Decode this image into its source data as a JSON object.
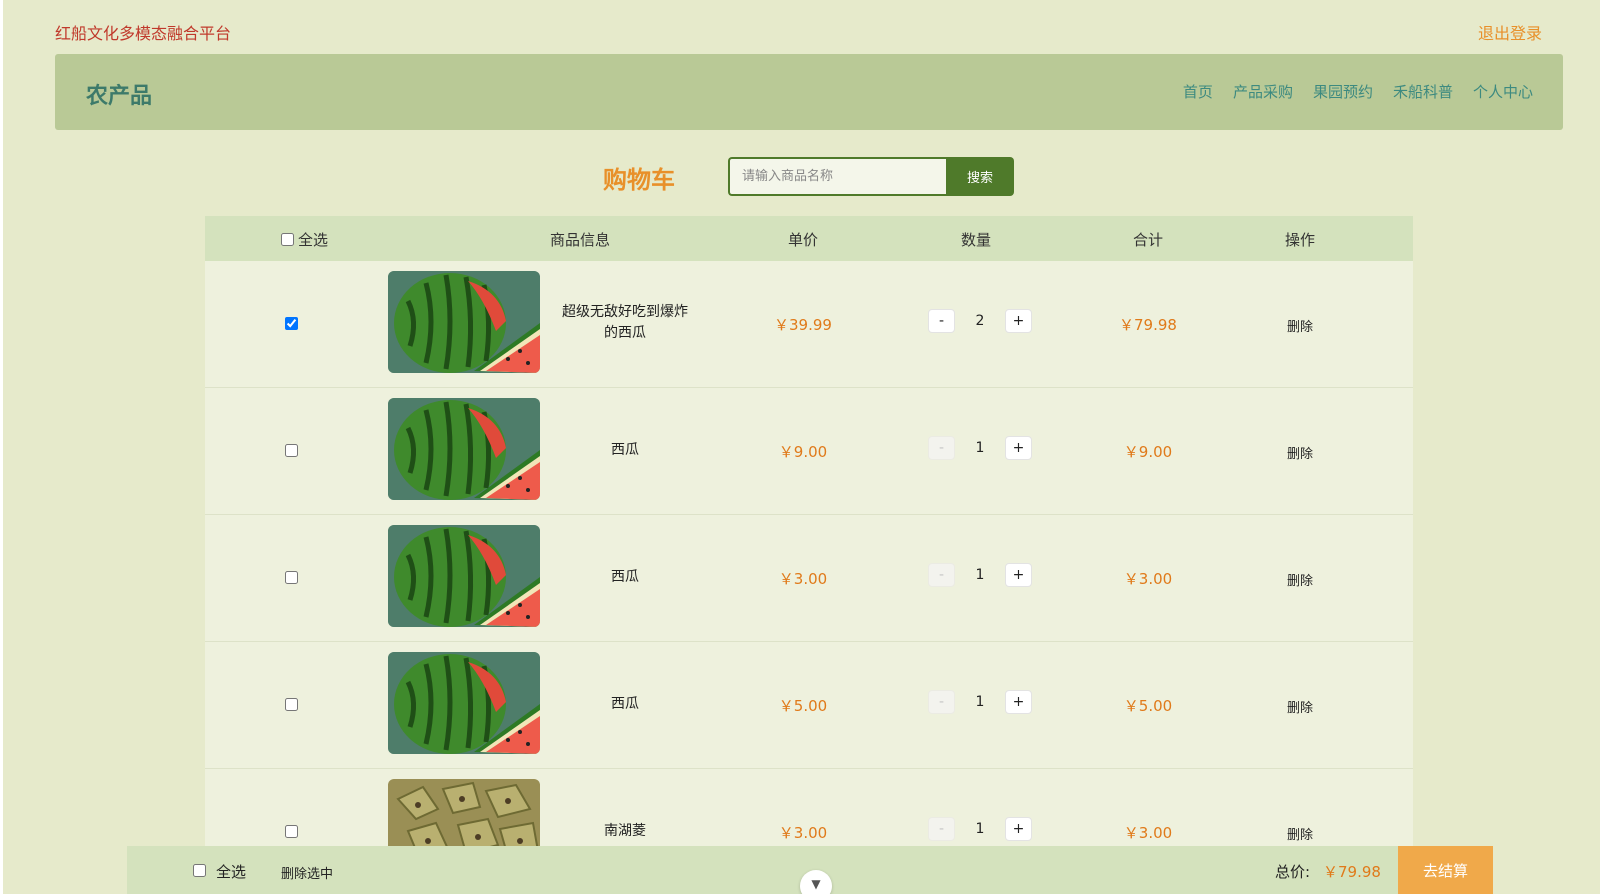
{
  "site_title": "红船文化多模态融合平台",
  "logout_label": "退出登录",
  "nav": {
    "brand": "农产品",
    "links": [
      "首页",
      "产品采购",
      "果园预约",
      "禾船科普",
      "个人中心"
    ]
  },
  "cart": {
    "title": "购物车",
    "search_placeholder": "请输入商品名称",
    "search_button": "搜索",
    "headers": {
      "select_all": "全选",
      "info": "商品信息",
      "unit_price": "单价",
      "quantity": "数量",
      "subtotal": "合计",
      "action": "操作"
    },
    "items": [
      {
        "checked": true,
        "name_line1": "超级无敌好吃到爆炸",
        "name_line2": "的西瓜",
        "image": "watermelon",
        "price": "￥39.99",
        "minus": "-",
        "qty": "2",
        "plus": "+",
        "subtotal": "￥79.98",
        "action": "删除"
      },
      {
        "checked": false,
        "name_line1": "西瓜",
        "name_line2": "",
        "image": "watermelon",
        "price": "￥9.00",
        "minus": "-",
        "qty": "1",
        "plus": "+",
        "subtotal": "￥9.00",
        "action": "删除"
      },
      {
        "checked": false,
        "name_line1": "西瓜",
        "name_line2": "",
        "image": "watermelon",
        "price": "￥3.00",
        "minus": "-",
        "qty": "1",
        "plus": "+",
        "subtotal": "￥3.00",
        "action": "删除"
      },
      {
        "checked": false,
        "name_line1": "西瓜",
        "name_line2": "",
        "image": "watermelon",
        "price": "￥5.00",
        "minus": "-",
        "qty": "1",
        "plus": "+",
        "subtotal": "￥5.00",
        "action": "删除"
      },
      {
        "checked": false,
        "name_line1": "南湖菱",
        "name_line2": "",
        "image": "water-caltrop",
        "price": "￥3.00",
        "minus": "-",
        "qty": "1",
        "plus": "+",
        "subtotal": "￥3.00",
        "action": "删除"
      }
    ]
  },
  "footer": {
    "select_all": "全选",
    "delete_selected": "删除选中",
    "total_label": "总价:",
    "total_value": "￥79.98",
    "checkout_button": "去结算",
    "scroll_icon": "chevron-down-icon"
  },
  "colors": {
    "background": "#e6eacb",
    "navbar": "#b9c996",
    "accent_orange": "#e07a1a",
    "search_button": "#4f7a2a",
    "checkout": "#f0a94a"
  }
}
